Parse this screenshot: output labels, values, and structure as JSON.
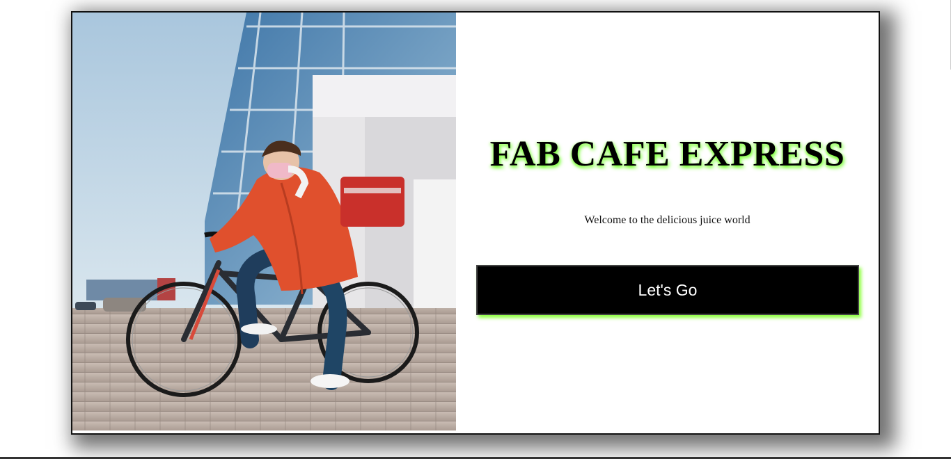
{
  "hero": {
    "image_alt": "Delivery courier in orange jacket and face mask riding a bicycle with a red delivery backpack in front of a glass building"
  },
  "content": {
    "title": "FAB CAFE EXPRESS",
    "tagline": "Welcome to the delicious juice world",
    "cta_label": "Let's Go"
  },
  "colors": {
    "accent_glow": "#7bff3a",
    "button_bg": "#000000",
    "button_text": "#ffffff"
  }
}
